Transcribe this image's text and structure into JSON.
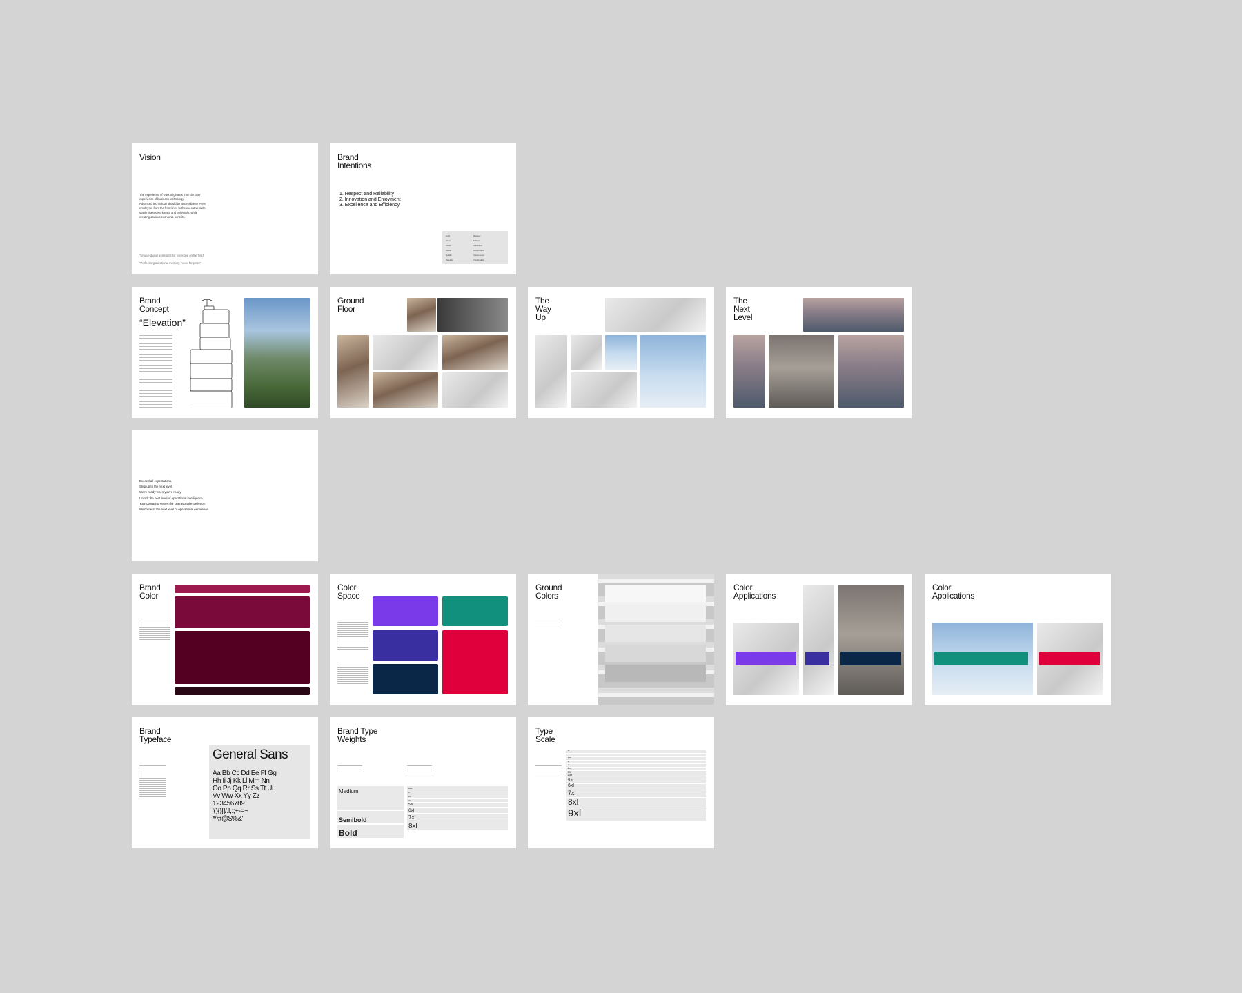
{
  "slides": {
    "vision": {
      "title": "Vision",
      "paragraphs": [
        "The experience of work originates from the user experience of business technology.",
        "Advanced technology should be accessible to every employee, from the front lines to the executive suite.",
        "Maple makes work easy and enjoyable, while creating obvious economic benefits."
      ],
      "quotes": [
        "\"Unique digital assistants for everyone on the field\"",
        "\"Perfect organizational memory, never forgotten\""
      ]
    },
    "intentions": {
      "title": "Brand\nIntentions",
      "list": [
        "1. Respect and Reliability",
        "2. Innovation and Enjoyment",
        "3. Excellence and Efficiency"
      ],
      "table_left": [
        "Light",
        "Clean",
        "Smart",
        "Stable",
        "Quality",
        "Beautiful"
      ],
      "table_right": [
        "Relaxed",
        "Efficient",
        "Advanced",
        "Responsible",
        "Autonomous",
        "Comfortable"
      ]
    },
    "concept": {
      "title": "Brand\nConcept",
      "headline": "“Elevation”"
    },
    "ground_floor": {
      "title": "Ground\nFloor"
    },
    "way_up": {
      "title": "The\nWay\nUp"
    },
    "next_level": {
      "title": "The\nNext\nLevel"
    },
    "tagline": {
      "lines": [
        "Exceed all expectations.",
        "Step up to the next level.",
        "We're ready when you're ready.",
        "Unlock the next level of operational intelligence.",
        "Your operating system for operational excellence.",
        "Welcome to the next level of operational excellence."
      ]
    },
    "brand_color": {
      "title": "Brand\nColor",
      "colors": [
        "#9c1a4e",
        "#7a0a3a",
        "#530022",
        "#2a0714"
      ]
    },
    "color_space": {
      "title": "Color\nSpace",
      "colors": {
        "purple": "#7b3aea",
        "teal": "#12907e",
        "indigo": "#3a2fa0",
        "navy": "#0b2748",
        "red": "#e0003c"
      }
    },
    "ground_colors": {
      "title": "Ground\nColors",
      "colors": [
        "#f7f7f7",
        "#f0f0f0",
        "#e6e6e6",
        "#d8d8d8",
        "#b8b8b8"
      ]
    },
    "color_apps_1": {
      "title": "Color\nApplications"
    },
    "color_apps_2": {
      "title": "Color\nApplications"
    },
    "typeface": {
      "title": "Brand\nTypeface",
      "font_name": "General Sans",
      "glyphs": [
        "Aa Bb Cc Dd Ee Ff Gg",
        "Hh Ii Jj Kk Ll Mm Nn",
        "Oo Pp Qq Rr Ss Tt Uu",
        "Vv Ww Xx Yy Zz",
        "123456789",
        "'(){}[]/.!,:;+-=~",
        "*^#@$%&'"
      ]
    },
    "weights": {
      "title": "Brand Type\nWeights",
      "names": [
        "Medium",
        "Semibold",
        "Bold"
      ],
      "sizes": [
        "base",
        "xl",
        "2xl",
        "3xl",
        "5xl",
        "6xl",
        "7xl",
        "8xl"
      ]
    },
    "type_scale": {
      "title": "Type\nScale",
      "sizes": [
        "xs",
        "sm",
        "base",
        "lg",
        "xl",
        "2xl",
        "3xl",
        "4xl",
        "5xl",
        "6xl",
        "7xl",
        "8xl",
        "9xl"
      ]
    }
  }
}
